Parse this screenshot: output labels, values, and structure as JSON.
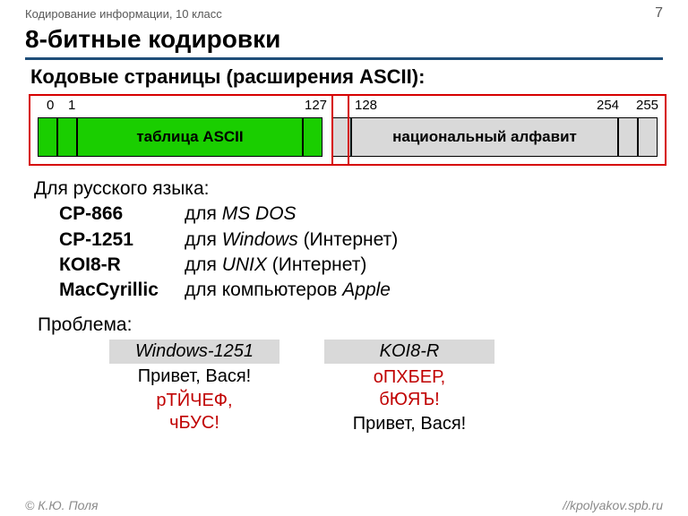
{
  "header": {
    "course": "Кодирование информации, 10 класс",
    "page_number": "7"
  },
  "title": "8-битные кодировки",
  "subtitle": "Кодовые страницы (расширения ASCII):",
  "diagram": {
    "labels": {
      "n0": "0",
      "n1": "1",
      "n127": "127",
      "n128": "128",
      "n254": "254",
      "n255": "255"
    },
    "ascii_label": "таблица ASCII",
    "national_label": "национальный алфавит"
  },
  "body": {
    "intro": "Для русского языка:",
    "encodings": [
      {
        "name": "CP-866",
        "prefix": "для ",
        "italic": "MS DOS",
        "suffix": ""
      },
      {
        "name": "CP-1251",
        "prefix": "для ",
        "italic": "Windows",
        "suffix": " (Интернет)"
      },
      {
        "name": "КОI8-R",
        "prefix": "для ",
        "italic": "UNIX",
        "suffix": " (Интернет)"
      },
      {
        "name": "MacCyrillic",
        "prefix": "для компьютеров ",
        "italic": "Apple",
        "suffix": ""
      }
    ],
    "problem_label": "Проблема:"
  },
  "problem": {
    "columns": [
      {
        "head": "Windows-1251",
        "plain": "Привет, Вася!",
        "garbled1": "рТЙЧЕФ,",
        "garbled2": "чБУС!"
      },
      {
        "head": "KOI8-R",
        "garbled1": "оПХБЕР,",
        "garbled2": "бЮЯЪ!",
        "plain": "Привет, Вася!"
      }
    ]
  },
  "footer": {
    "author": "К.Ю. Поля",
    "site": "//kpolyakov.spb.ru"
  }
}
